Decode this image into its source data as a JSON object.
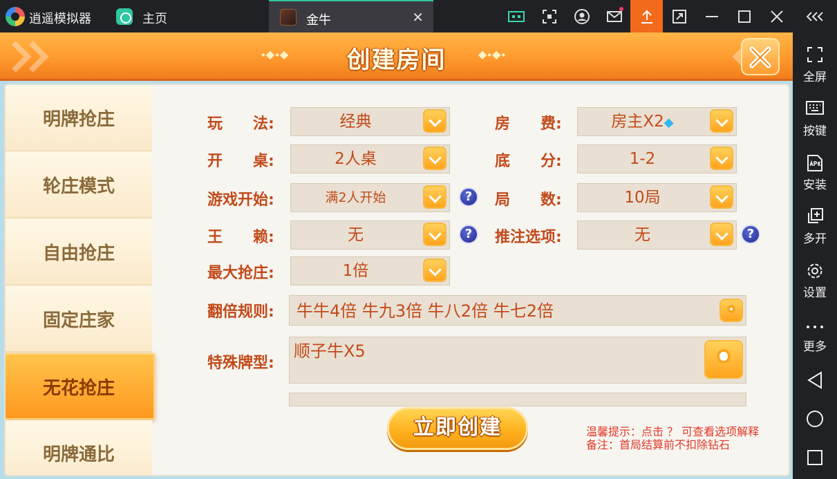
{
  "window": {
    "app_name": "逍遥模拟器",
    "home_tab": "主页",
    "active_tab": "金牛",
    "tab_close": "✕"
  },
  "toolbar_icons": [
    "keyboard-map-icon",
    "screenshot-icon",
    "account-icon",
    "mail-icon",
    "upload-icon",
    "restore-icon",
    "minimize-icon",
    "maximize-icon",
    "close-icon",
    "collapse-icon"
  ],
  "sidebar": {
    "items": [
      {
        "label": "全屏",
        "icon": "fullscreen-icon"
      },
      {
        "label": "按键",
        "icon": "keyboard-icon"
      },
      {
        "label": "安装",
        "icon": "apk-icon"
      },
      {
        "label": "多开",
        "icon": "multi-instance-icon"
      },
      {
        "label": "设置",
        "icon": "gear-icon"
      },
      {
        "label": "更多",
        "icon": "more-icon"
      }
    ],
    "nav": [
      "back",
      "home",
      "recents"
    ]
  },
  "dialog": {
    "title": "创建房间",
    "title_decor_left": "⬩◆⬩◆",
    "title_decor_right": "◆⬩◆⬩"
  },
  "modes": [
    {
      "label": "明牌抢庄",
      "active": false
    },
    {
      "label": "轮庄模式",
      "active": false
    },
    {
      "label": "自由抢庄",
      "active": false
    },
    {
      "label": "固定庄家",
      "active": false
    },
    {
      "label": "无花抢庄",
      "active": true
    },
    {
      "label": "明牌通比",
      "active": false
    }
  ],
  "form": {
    "play_label": "玩　　法:",
    "play_value": "经典",
    "fee_label": "房　　费:",
    "fee_value": "房主X2",
    "table_label": "开　　桌:",
    "table_value": "2人桌",
    "base_label": "底　　分:",
    "base_value": "1-2",
    "start_label": "游戏开始:",
    "start_value": "满2人开始",
    "rounds_label": "局　　数:",
    "rounds_value": "10局",
    "wild_label": "王　　赖:",
    "wild_value": "无",
    "push_label": "推注选项:",
    "push_value": "无",
    "max_grab_label": "最大抢庄:",
    "max_grab_value": "1倍",
    "double_rule_label": "翻倍规则:",
    "double_rule_value": "牛牛4倍 牛九3倍 牛八2倍 牛七2倍",
    "special_label": "特殊牌型:",
    "special_value": "顺子牛X5",
    "help_glyph": "?"
  },
  "actions": {
    "create_label": "立即创建"
  },
  "tips": {
    "line1": "温馨提示：点击 ？ 可查看选项解释",
    "line2": "备注：首局结算前不扣除钻石"
  },
  "colors": {
    "accent_orange": "#ff9a2e",
    "label_red": "#c24a1a",
    "upload_orange": "#f26a1b"
  }
}
